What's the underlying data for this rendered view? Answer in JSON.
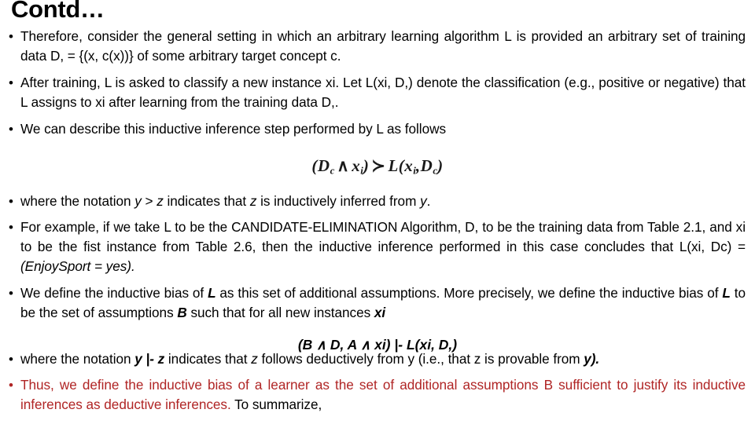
{
  "slide": {
    "title": "Contd…",
    "accent_red": "#B02525",
    "text_color": "#000000",
    "background": "#ffffff",
    "bullet_glyph": "•"
  },
  "bullets": [
    {
      "id": "bullet-therefore",
      "parts": [
        {
          "text": "Therefore, consider the general setting in which an arbitrary learning algorithm L is provided an arbitrary set of training data D, = {(x, c(x))} of some arbitrary target concept c.",
          "style": "normal",
          "color": "black"
        }
      ]
    },
    {
      "id": "bullet-after-training",
      "parts": [
        {
          "text": "After training, L is asked to classify a new instance xi. Let L(xi, D,) denote the classification (e.g., positive or negative) that L assigns to xi after learning from the training data D,.",
          "style": "normal",
          "color": "black"
        }
      ]
    },
    {
      "id": "bullet-describe",
      "parts": [
        {
          "text": "We can describe this inductive inference step performed by L as follows",
          "style": "normal",
          "color": "black"
        }
      ]
    },
    {
      "id": "bullet-notation-inductive",
      "parts": [
        {
          "text": "where the notation ",
          "style": "normal",
          "color": "black"
        },
        {
          "text": "y",
          "style": "italic",
          "color": "black"
        },
        {
          "text": " > ",
          "style": "normal",
          "color": "black"
        },
        {
          "text": "z",
          "style": "italic",
          "color": "black"
        },
        {
          "text": " indicates that ",
          "style": "normal",
          "color": "black"
        },
        {
          "text": "z",
          "style": "italic",
          "color": "black"
        },
        {
          "text": " is inductively inferred from ",
          "style": "normal",
          "color": "black"
        },
        {
          "text": "y",
          "style": "italic",
          "color": "black"
        },
        {
          "text": ".",
          "style": "normal",
          "color": "black"
        }
      ]
    },
    {
      "id": "bullet-example",
      "parts": [
        {
          "text": "For example, if we take L to be the CANDIDATE-ELIMINATION Algorithm, D, to be the training data from Table 2.1, and xi to be the fist instance from Table 2.6, then the inductive inference performed in this case concludes that L(xi, Dc) = ",
          "style": "normal",
          "color": "black"
        },
        {
          "text": "(EnjoySport = yes).",
          "style": "italic",
          "color": "black"
        }
      ]
    },
    {
      "id": "bullet-define-bias",
      "parts": [
        {
          "text": "We define the inductive bias of ",
          "style": "normal",
          "color": "black"
        },
        {
          "text": "L",
          "style": "bolditalic",
          "color": "black"
        },
        {
          "text": " as this set of additional assumptions. More precisely, we define the inductive bias of ",
          "style": "normal",
          "color": "black"
        },
        {
          "text": "L",
          "style": "bolditalic",
          "color": "black"
        },
        {
          "text": " to be the set of assumptions ",
          "style": "normal",
          "color": "black"
        },
        {
          "text": "B",
          "style": "bolditalic",
          "color": "black"
        },
        {
          "text": " such that for all new instances ",
          "style": "normal",
          "color": "black"
        },
        {
          "text": "xi",
          "style": "bolditalic",
          "color": "black"
        }
      ]
    },
    {
      "id": "bullet-notation-deductive",
      "parts": [
        {
          "text": "where the notation ",
          "style": "normal",
          "color": "black"
        },
        {
          "text": "y |- z",
          "style": "bolditalic",
          "color": "black"
        },
        {
          "text": " indicates that ",
          "style": "normal",
          "color": "black"
        },
        {
          "text": "z",
          "style": "italic",
          "color": "black"
        },
        {
          "text": " follows deductively from y (i.e., that z is provable from ",
          "style": "normal",
          "color": "black"
        },
        {
          "text": "y).",
          "style": "bolditalic",
          "color": "black"
        }
      ]
    },
    {
      "id": "bullet-thus",
      "parts": [
        {
          "text": "Thus, we define the inductive bias of a learner as the set of additional assumptions B sufficient to justify its inductive inferences as deductive inferences. ",
          "style": "normal",
          "color": "red"
        },
        {
          "text": "To summarize,",
          "style": "normal",
          "color": "black"
        }
      ]
    }
  ],
  "formulas": {
    "inductive": {
      "label": "inductive-inference-formula",
      "plain": "(Dc ∧ xi) ≻ L(xi , Dc)",
      "tokens": [
        {
          "t": "(",
          "k": "plain"
        },
        {
          "t": "D",
          "k": "var"
        },
        {
          "t": "c",
          "k": "sub"
        },
        {
          "t": "∧",
          "k": "op"
        },
        {
          "t": "x",
          "k": "var"
        },
        {
          "t": "i",
          "k": "sub"
        },
        {
          "t": ")",
          "k": "plain"
        },
        {
          "t": "≻",
          "k": "op"
        },
        {
          "t": "L",
          "k": "var"
        },
        {
          "t": "(",
          "k": "plain"
        },
        {
          "t": "x",
          "k": "var"
        },
        {
          "t": "i",
          "k": "sub"
        },
        {
          "t": ",",
          "k": "plain"
        },
        {
          "t": "D",
          "k": "var"
        },
        {
          "t": "c",
          "k": "sub"
        },
        {
          "t": ")",
          "k": "plain"
        }
      ]
    },
    "deductive": {
      "label": "deductive-inference-formula",
      "plain": "(B ∧ D, A  ∧  xi) |- L(xi, D,)"
    }
  }
}
